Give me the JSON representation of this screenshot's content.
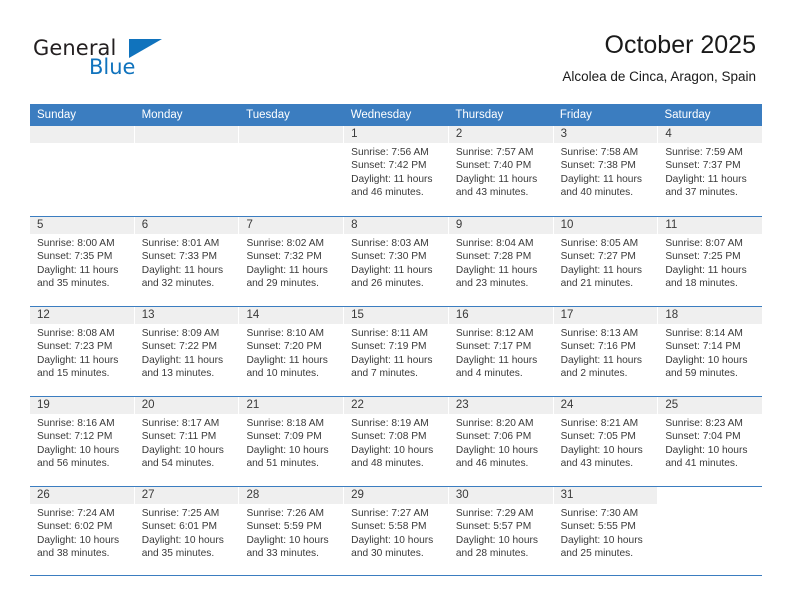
{
  "brand": {
    "line1": "General",
    "line2": "Blue",
    "flag_icon": "triangle-flag-icon",
    "accent_color": "#1073bd"
  },
  "header": {
    "title": "October 2025",
    "subtitle": "Alcolea de Cinca, Aragon, Spain"
  },
  "calendar": {
    "header_bg": "#3b7dc0",
    "day_band_bg": "#efefef",
    "weekdays": [
      "Sunday",
      "Monday",
      "Tuesday",
      "Wednesday",
      "Thursday",
      "Friday",
      "Saturday"
    ],
    "weeks": [
      [
        {
          "day": "",
          "empty": true
        },
        {
          "day": "",
          "empty": true
        },
        {
          "day": "",
          "empty": true
        },
        {
          "day": "1",
          "sunrise": "Sunrise: 7:56 AM",
          "sunset": "Sunset: 7:42 PM",
          "daylight1": "Daylight: 11 hours",
          "daylight2": "and 46 minutes."
        },
        {
          "day": "2",
          "sunrise": "Sunrise: 7:57 AM",
          "sunset": "Sunset: 7:40 PM",
          "daylight1": "Daylight: 11 hours",
          "daylight2": "and 43 minutes."
        },
        {
          "day": "3",
          "sunrise": "Sunrise: 7:58 AM",
          "sunset": "Sunset: 7:38 PM",
          "daylight1": "Daylight: 11 hours",
          "daylight2": "and 40 minutes."
        },
        {
          "day": "4",
          "sunrise": "Sunrise: 7:59 AM",
          "sunset": "Sunset: 7:37 PM",
          "daylight1": "Daylight: 11 hours",
          "daylight2": "and 37 minutes."
        }
      ],
      [
        {
          "day": "5",
          "sunrise": "Sunrise: 8:00 AM",
          "sunset": "Sunset: 7:35 PM",
          "daylight1": "Daylight: 11 hours",
          "daylight2": "and 35 minutes."
        },
        {
          "day": "6",
          "sunrise": "Sunrise: 8:01 AM",
          "sunset": "Sunset: 7:33 PM",
          "daylight1": "Daylight: 11 hours",
          "daylight2": "and 32 minutes."
        },
        {
          "day": "7",
          "sunrise": "Sunrise: 8:02 AM",
          "sunset": "Sunset: 7:32 PM",
          "daylight1": "Daylight: 11 hours",
          "daylight2": "and 29 minutes."
        },
        {
          "day": "8",
          "sunrise": "Sunrise: 8:03 AM",
          "sunset": "Sunset: 7:30 PM",
          "daylight1": "Daylight: 11 hours",
          "daylight2": "and 26 minutes."
        },
        {
          "day": "9",
          "sunrise": "Sunrise: 8:04 AM",
          "sunset": "Sunset: 7:28 PM",
          "daylight1": "Daylight: 11 hours",
          "daylight2": "and 23 minutes."
        },
        {
          "day": "10",
          "sunrise": "Sunrise: 8:05 AM",
          "sunset": "Sunset: 7:27 PM",
          "daylight1": "Daylight: 11 hours",
          "daylight2": "and 21 minutes."
        },
        {
          "day": "11",
          "sunrise": "Sunrise: 8:07 AM",
          "sunset": "Sunset: 7:25 PM",
          "daylight1": "Daylight: 11 hours",
          "daylight2": "and 18 minutes."
        }
      ],
      [
        {
          "day": "12",
          "sunrise": "Sunrise: 8:08 AM",
          "sunset": "Sunset: 7:23 PM",
          "daylight1": "Daylight: 11 hours",
          "daylight2": "and 15 minutes."
        },
        {
          "day": "13",
          "sunrise": "Sunrise: 8:09 AM",
          "sunset": "Sunset: 7:22 PM",
          "daylight1": "Daylight: 11 hours",
          "daylight2": "and 13 minutes."
        },
        {
          "day": "14",
          "sunrise": "Sunrise: 8:10 AM",
          "sunset": "Sunset: 7:20 PM",
          "daylight1": "Daylight: 11 hours",
          "daylight2": "and 10 minutes."
        },
        {
          "day": "15",
          "sunrise": "Sunrise: 8:11 AM",
          "sunset": "Sunset: 7:19 PM",
          "daylight1": "Daylight: 11 hours",
          "daylight2": "and 7 minutes."
        },
        {
          "day": "16",
          "sunrise": "Sunrise: 8:12 AM",
          "sunset": "Sunset: 7:17 PM",
          "daylight1": "Daylight: 11 hours",
          "daylight2": "and 4 minutes."
        },
        {
          "day": "17",
          "sunrise": "Sunrise: 8:13 AM",
          "sunset": "Sunset: 7:16 PM",
          "daylight1": "Daylight: 11 hours",
          "daylight2": "and 2 minutes."
        },
        {
          "day": "18",
          "sunrise": "Sunrise: 8:14 AM",
          "sunset": "Sunset: 7:14 PM",
          "daylight1": "Daylight: 10 hours",
          "daylight2": "and 59 minutes."
        }
      ],
      [
        {
          "day": "19",
          "sunrise": "Sunrise: 8:16 AM",
          "sunset": "Sunset: 7:12 PM",
          "daylight1": "Daylight: 10 hours",
          "daylight2": "and 56 minutes."
        },
        {
          "day": "20",
          "sunrise": "Sunrise: 8:17 AM",
          "sunset": "Sunset: 7:11 PM",
          "daylight1": "Daylight: 10 hours",
          "daylight2": "and 54 minutes."
        },
        {
          "day": "21",
          "sunrise": "Sunrise: 8:18 AM",
          "sunset": "Sunset: 7:09 PM",
          "daylight1": "Daylight: 10 hours",
          "daylight2": "and 51 minutes."
        },
        {
          "day": "22",
          "sunrise": "Sunrise: 8:19 AM",
          "sunset": "Sunset: 7:08 PM",
          "daylight1": "Daylight: 10 hours",
          "daylight2": "and 48 minutes."
        },
        {
          "day": "23",
          "sunrise": "Sunrise: 8:20 AM",
          "sunset": "Sunset: 7:06 PM",
          "daylight1": "Daylight: 10 hours",
          "daylight2": "and 46 minutes."
        },
        {
          "day": "24",
          "sunrise": "Sunrise: 8:21 AM",
          "sunset": "Sunset: 7:05 PM",
          "daylight1": "Daylight: 10 hours",
          "daylight2": "and 43 minutes."
        },
        {
          "day": "25",
          "sunrise": "Sunrise: 8:23 AM",
          "sunset": "Sunset: 7:04 PM",
          "daylight1": "Daylight: 10 hours",
          "daylight2": "and 41 minutes."
        }
      ],
      [
        {
          "day": "26",
          "sunrise": "Sunrise: 7:24 AM",
          "sunset": "Sunset: 6:02 PM",
          "daylight1": "Daylight: 10 hours",
          "daylight2": "and 38 minutes."
        },
        {
          "day": "27",
          "sunrise": "Sunrise: 7:25 AM",
          "sunset": "Sunset: 6:01 PM",
          "daylight1": "Daylight: 10 hours",
          "daylight2": "and 35 minutes."
        },
        {
          "day": "28",
          "sunrise": "Sunrise: 7:26 AM",
          "sunset": "Sunset: 5:59 PM",
          "daylight1": "Daylight: 10 hours",
          "daylight2": "and 33 minutes."
        },
        {
          "day": "29",
          "sunrise": "Sunrise: 7:27 AM",
          "sunset": "Sunset: 5:58 PM",
          "daylight1": "Daylight: 10 hours",
          "daylight2": "and 30 minutes."
        },
        {
          "day": "30",
          "sunrise": "Sunrise: 7:29 AM",
          "sunset": "Sunset: 5:57 PM",
          "daylight1": "Daylight: 10 hours",
          "daylight2": "and 28 minutes."
        },
        {
          "day": "31",
          "sunrise": "Sunrise: 7:30 AM",
          "sunset": "Sunset: 5:55 PM",
          "daylight1": "Daylight: 10 hours",
          "daylight2": "and 25 minutes."
        },
        {
          "day": "",
          "empty": true,
          "blank": true
        }
      ]
    ]
  }
}
